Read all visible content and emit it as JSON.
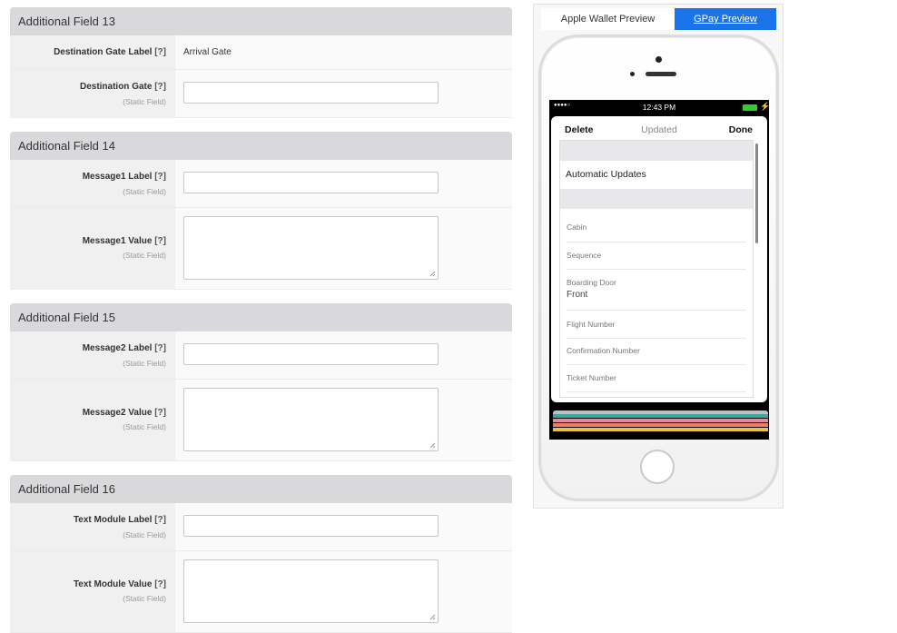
{
  "sections": [
    {
      "title": "Additional Field 13",
      "rows": [
        {
          "label": "Destination Gate Label",
          "help": "[?]",
          "value": "Arrival Gate"
        },
        {
          "label": "Destination Gate",
          "help": "[?]",
          "sub": "(Static Field)"
        }
      ]
    },
    {
      "title": "Additional Field 14",
      "rows": [
        {
          "label": "Message1 Label",
          "help": "[?]",
          "sub": "(Static Field)"
        },
        {
          "label": "Message1 Value",
          "help": "[?]",
          "sub": "(Static Field)"
        }
      ]
    },
    {
      "title": "Additional Field 15",
      "rows": [
        {
          "label": "Message2 Label",
          "help": "[?]",
          "sub": "(Static Field)"
        },
        {
          "label": "Message2 Value",
          "help": "[?]",
          "sub": "(Static Field)"
        }
      ]
    },
    {
      "title": "Additional Field 16",
      "rows": [
        {
          "label": "Text Module Label",
          "help": "[?]",
          "sub": "(Static Field)"
        },
        {
          "label": "Text Module Value",
          "help": "[?]",
          "sub": "(Static Field)"
        }
      ]
    }
  ],
  "preview": {
    "tabs": {
      "apple": "Apple Wallet Preview",
      "gpay": "GPay Preview"
    },
    "status_bar": {
      "signal": "●●●●○",
      "time": "12:43 PM"
    },
    "card_header": {
      "delete": "Delete",
      "updated": "Updated",
      "done": "Done"
    },
    "automatic_updates": "Automatic Updates",
    "fields": [
      {
        "label": "Cabin"
      },
      {
        "label": "Sequence"
      },
      {
        "label": "Boarding Door",
        "value": "Front"
      },
      {
        "label": "Flight Number"
      },
      {
        "label": "Confirmation Number"
      },
      {
        "label": "Ticket Number"
      }
    ],
    "colors": {
      "gpay_tab": "#1a73e8",
      "battery": "#33cc33"
    }
  }
}
